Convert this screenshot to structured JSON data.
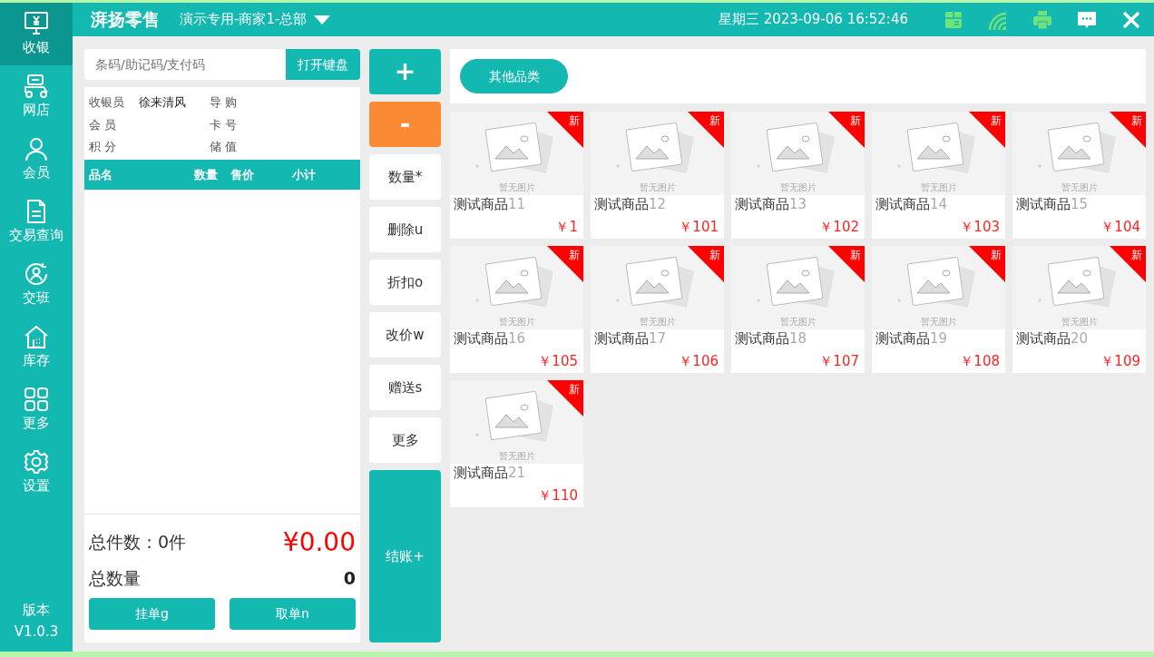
{
  "sidebar": {
    "items": [
      {
        "label": "收银",
        "selected": true
      },
      {
        "label": "网店",
        "selected": false
      },
      {
        "label": "会员",
        "selected": false
      },
      {
        "label": "交易查询",
        "selected": false
      },
      {
        "label": "交班",
        "selected": false
      },
      {
        "label": "库存",
        "selected": false
      },
      {
        "label": "更多",
        "selected": false
      },
      {
        "label": "设置",
        "selected": false
      }
    ],
    "version_label": "版本",
    "version": "V1.0.3"
  },
  "header": {
    "logo": "湃扬零售",
    "store": "演示专用-商家1-总部",
    "datetime": "星期三 2023-09-06 16:52:46"
  },
  "order_panel": {
    "search": {
      "placeholder": "条码/助记码/支付码",
      "button": "打开键盘"
    },
    "info": [
      {
        "label": "收银员",
        "value": "徐来清风"
      },
      {
        "label": "导 购"
      },
      {
        "label": "会 员"
      },
      {
        "label": "卡 号"
      },
      {
        "label": "积 分"
      },
      {
        "label": "储 值"
      }
    ],
    "table": {
      "columns": [
        "品名",
        "数量",
        "售价",
        "小计"
      ]
    },
    "total_items": "总件数：0件",
    "total_amount": "¥0.00",
    "total_qty_label": "总数量",
    "total_qty": "0",
    "buttons": [
      "挂单g",
      "取单n"
    ]
  },
  "actions": [
    {
      "label": "+",
      "kind": "primary"
    },
    {
      "label": "-",
      "kind": "warning"
    },
    {
      "label": "数量*",
      "kind": "plain"
    },
    {
      "label": "删除u",
      "kind": "plain"
    },
    {
      "label": "折扣o",
      "kind": "plain"
    },
    {
      "label": "改价w",
      "kind": "plain"
    },
    {
      "label": "赠送s",
      "kind": "plain"
    },
    {
      "label": "更多",
      "kind": "plain"
    },
    {
      "label": "结账+",
      "kind": "checkout"
    }
  ],
  "categories": [
    {
      "label": "其他品类",
      "selected": true
    }
  ],
  "products": [
    {
      "name": "测试商品",
      "code": "11",
      "price": "￥1",
      "badge": "新",
      "image_text": "暂无图片"
    },
    {
      "name": "测试商品",
      "code": "12",
      "price": "￥101",
      "badge": "新",
      "image_text": "暂无图片"
    },
    {
      "name": "测试商品",
      "code": "13",
      "price": "￥102",
      "badge": "新",
      "image_text": "暂无图片"
    },
    {
      "name": "测试商品",
      "code": "14",
      "price": "￥103",
      "badge": "新",
      "image_text": "暂无图片"
    },
    {
      "name": "测试商品",
      "code": "15",
      "price": "￥104",
      "badge": "新",
      "image_text": "暂无图片"
    },
    {
      "name": "测试商品",
      "code": "16",
      "price": "￥105",
      "badge": "新",
      "image_text": "暂无图片"
    },
    {
      "name": "测试商品",
      "code": "17",
      "price": "￥106",
      "badge": "新",
      "image_text": "暂无图片"
    },
    {
      "name": "测试商品",
      "code": "18",
      "price": "￥107",
      "badge": "新",
      "image_text": "暂无图片"
    },
    {
      "name": "测试商品",
      "code": "19",
      "price": "￥108",
      "badge": "新",
      "image_text": "暂无图片"
    },
    {
      "name": "测试商品",
      "code": "20",
      "price": "￥109",
      "badge": "新",
      "image_text": "暂无图片"
    },
    {
      "name": "测试商品",
      "code": "21",
      "price": "￥110",
      "badge": "新",
      "image_text": "暂无图片"
    }
  ]
}
